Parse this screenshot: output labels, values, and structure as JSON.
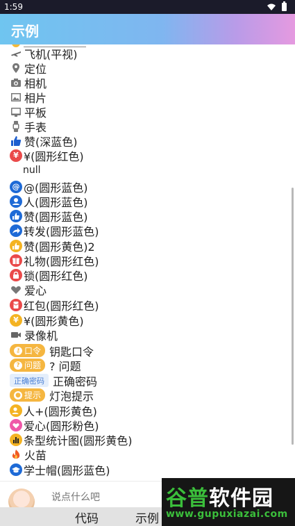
{
  "status_bar": {
    "time": "1:59"
  },
  "app_bar": {
    "title": "示例"
  },
  "rows": [
    {
      "label": "飞机(平视)",
      "icon": "airplane-icon"
    },
    {
      "label": "定位",
      "icon": "location-pin-icon"
    },
    {
      "label": "相机",
      "icon": "camera-icon"
    },
    {
      "label": "相片",
      "icon": "photo-icon"
    },
    {
      "label": "平板",
      "icon": "tablet-icon"
    },
    {
      "label": "手表",
      "icon": "watch-icon"
    },
    {
      "label": "赞(深蓝色)",
      "icon": "thumbs-up-icon"
    },
    {
      "label": "¥(圆形红色)",
      "icon": "yuan-circle-red-icon",
      "glyph": "¥"
    },
    {
      "label": "null",
      "icon": ""
    },
    {
      "label": "@(圆形蓝色)",
      "icon": "at-circle-blue-icon",
      "glyph": "@"
    },
    {
      "label": "人(圆形蓝色)",
      "icon": "person-circle-blue-icon"
    },
    {
      "label": "赞(圆形蓝色)",
      "icon": "thumbs-up-circle-blue-icon"
    },
    {
      "label": "转发(圆形蓝色)",
      "icon": "share-circle-blue-icon"
    },
    {
      "label": "赞(圆形黄色)2",
      "icon": "thumbs-up-circle-yellow-icon"
    },
    {
      "label": "礼物(圆形红色)",
      "icon": "gift-circle-red-icon"
    },
    {
      "label": "锁(圆形红色)",
      "icon": "lock-circle-red-icon"
    },
    {
      "label": "爱心",
      "icon": "heart-icon"
    },
    {
      "label": "红包(圆形红色)",
      "icon": "red-packet-circle-red-icon"
    },
    {
      "label": "¥(圆形黄色)",
      "icon": "yuan-circle-yellow-icon",
      "glyph": "¥"
    },
    {
      "label": "录像机",
      "icon": "video-camera-icon"
    },
    {
      "label": "钥匙口令",
      "badge": "口令",
      "badge_icon": "key-icon"
    },
    {
      "label": "? 问题",
      "badge": "问题",
      "badge_icon": "question-icon"
    },
    {
      "label": "正确密码",
      "badge": "正确密码",
      "badge_icon": ""
    },
    {
      "label": "灯泡提示",
      "badge": "提示",
      "badge_icon": "bulb-icon"
    },
    {
      "label": "人+(圆形黄色)",
      "icon": "person-add-circle-yellow-icon"
    },
    {
      "label": "爱心(圆形粉色)",
      "icon": "heart-circle-pink-icon"
    },
    {
      "label": "条型统计图(圆形黄色)",
      "icon": "bar-chart-circle-yellow-icon"
    },
    {
      "label": "火苗",
      "icon": "flame-icon"
    },
    {
      "label": "学士帽(圆形蓝色)",
      "icon": "graduation-cap-circle-blue-icon"
    }
  ],
  "input": {
    "placeholder": "说点什么吧"
  },
  "tabs": {
    "code": "代码",
    "example": "示例"
  },
  "watermark": {
    "title_a": "谷普",
    "title_b": "软件园",
    "url": "www.gupuxiazai.com"
  },
  "colors": {
    "blue": "#1e6ad6",
    "red": "#ea4a4a",
    "yellow": "#f4b322",
    "pink": "#ef58a8"
  }
}
